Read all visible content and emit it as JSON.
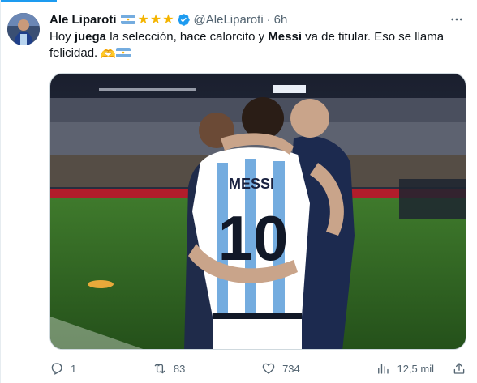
{
  "author": {
    "name": "Ale Liparoti",
    "stars": "★★★",
    "handle": "@AleLiparoti",
    "separator": "·",
    "time": "6h"
  },
  "tweet": {
    "text_part1": "Hoy ",
    "text_bold1": "juega",
    "text_part2": " la selección, hace calorcito y ",
    "text_bold2": "Messi",
    "text_part3": " va de titular. Eso se llama felicidad. ",
    "emoji": "🫶"
  },
  "media": {
    "jersey_name": "MESSI",
    "jersey_number": "10"
  },
  "actions": {
    "replies": "1",
    "reposts": "83",
    "likes": "734",
    "views": "12,5 mil"
  },
  "colors": {
    "accent": "#1d9bf0",
    "text": "#0f1419",
    "secondary": "#536471",
    "star": "#f4b400"
  },
  "icons": {
    "more": "more-icon",
    "verified": "verified-badge-icon",
    "reply": "reply-icon",
    "repost": "repost-icon",
    "like": "like-icon",
    "views": "views-icon",
    "share": "share-icon"
  }
}
